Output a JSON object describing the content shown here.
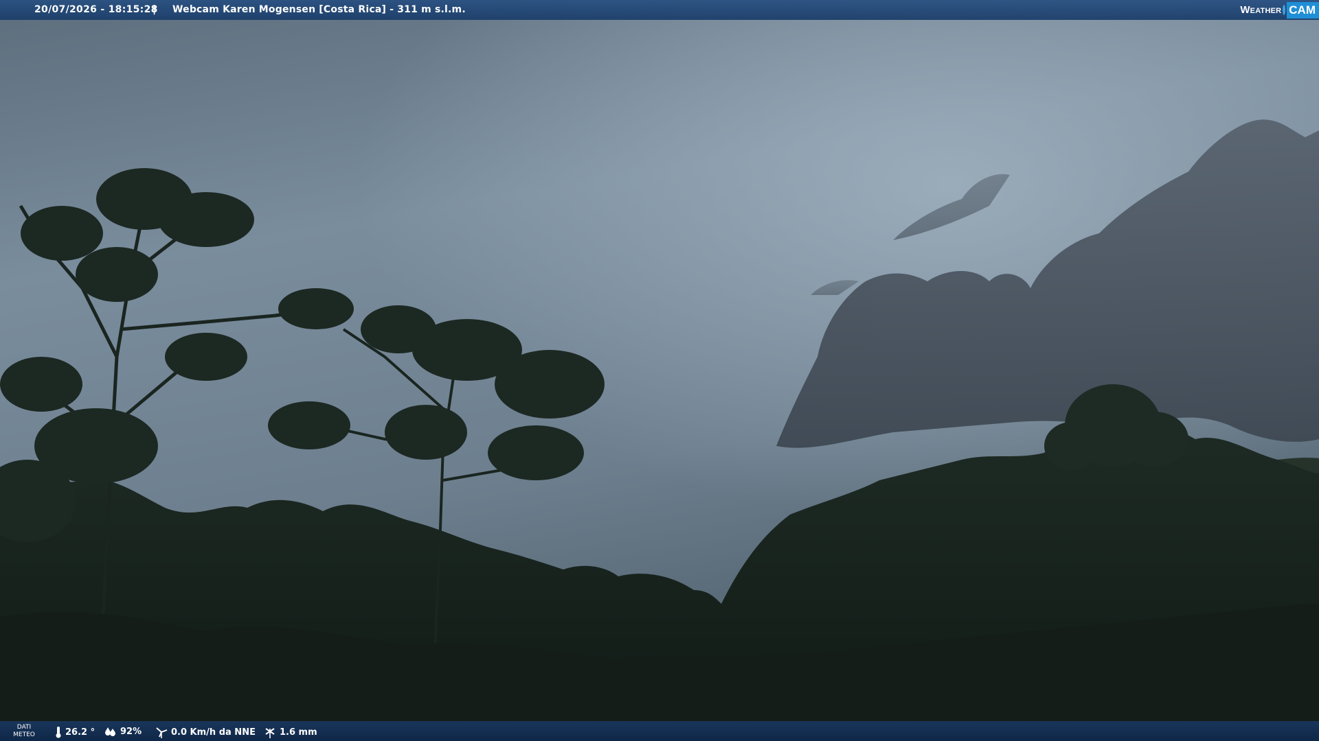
{
  "header": {
    "timestamp": "20/07/2026 - 18:15:28",
    "separator": "|",
    "location": "Webcam Karen Mogensen [Costa Rica]  - 311 m s.l.m.",
    "brand_weather": "Weather",
    "brand_cam": "CAM"
  },
  "footer": {
    "dati_line1": "DATI",
    "dati_line2": "METEO",
    "temperature": "26.2 °",
    "humidity": "92%",
    "wind": "0.0 Km/h da NNE",
    "rain": "1.6 mm"
  },
  "colors": {
    "sky_top": "#5c6f7f",
    "sky_mid": "#8a9cab",
    "cloud": "#4a5663",
    "forest": "#1d2a22",
    "bar": "#23508a"
  }
}
